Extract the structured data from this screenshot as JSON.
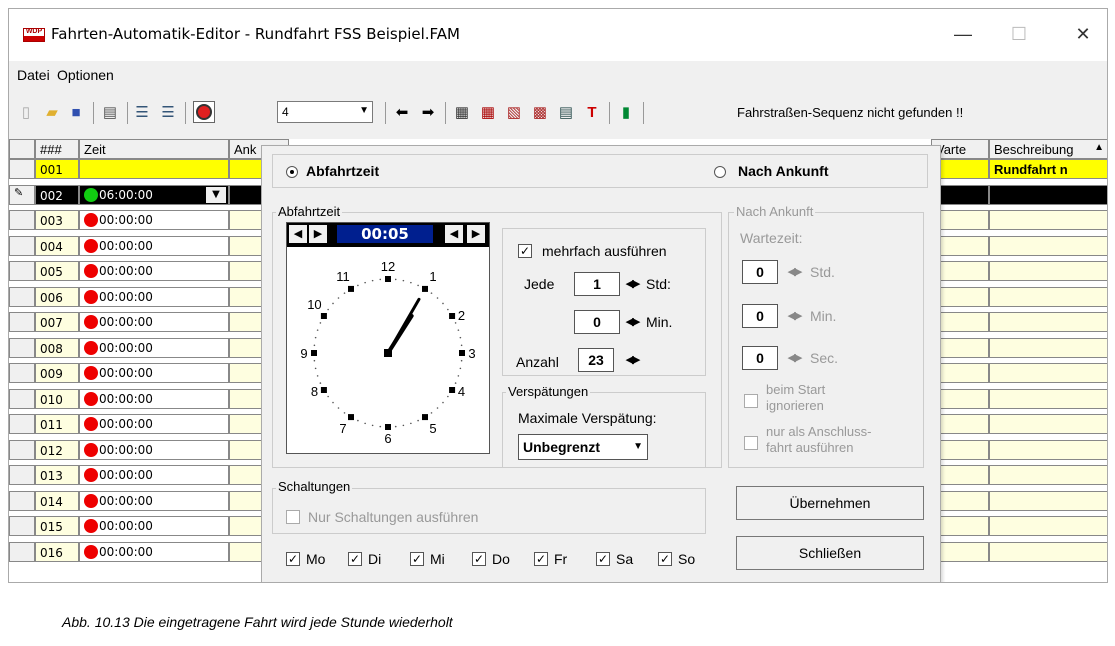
{
  "window": {
    "title": "Fahrten-Automatik-Editor - Rundfahrt FSS Beispiel.FAM",
    "icon_text": "WDP",
    "controls": [
      "—",
      "☐",
      "✕"
    ]
  },
  "menu": [
    "Datei",
    "Optionen"
  ],
  "toolbar": {
    "zoom_value": "4",
    "status": "Fahrstraßen-Sequenz nicht gefunden !!"
  },
  "grid": {
    "headers": [
      "###",
      "Zeit",
      "Ank",
      "Varte",
      "Beschreibung"
    ],
    "rows": [
      {
        "num": "001",
        "time": "",
        "desc": "Rundfahrt n"
      },
      {
        "num": "002",
        "time": "06:00:00",
        "desc": ""
      },
      {
        "num": "003",
        "time": "00:00:00"
      },
      {
        "num": "004",
        "time": "00:00:00"
      },
      {
        "num": "005",
        "time": "00:00:00"
      },
      {
        "num": "006",
        "time": "00:00:00"
      },
      {
        "num": "007",
        "time": "00:00:00"
      },
      {
        "num": "008",
        "time": "00:00:00"
      },
      {
        "num": "009",
        "time": "00:00:00"
      },
      {
        "num": "010",
        "time": "00:00:00"
      },
      {
        "num": "011",
        "time": "00:00:00"
      },
      {
        "num": "012",
        "time": "00:00:00"
      },
      {
        "num": "013",
        "time": "00:00:00"
      },
      {
        "num": "014",
        "time": "00:00:00"
      },
      {
        "num": "015",
        "time": "00:00:00"
      },
      {
        "num": "016",
        "time": "00:00:00"
      }
    ]
  },
  "dialog": {
    "mode_abfahrt": "Abfahrtzeit",
    "mode_ankunft": "Nach Ankunft",
    "abfahrt_group": "Abfahrtzeit",
    "clock_time": "00:05",
    "clock_numbers": [
      "12",
      "1",
      "2",
      "3",
      "4",
      "5",
      "6",
      "7",
      "8",
      "9",
      "10",
      "11"
    ],
    "clock_hour_value": 1,
    "clock_minute_value": 5,
    "mehrfach_label": "mehrfach ausführen",
    "jede_label": "Jede",
    "std_value": "1",
    "std_label": "Std:",
    "min_value": "0",
    "min_label": "Min.",
    "anzahl_label": "Anzahl",
    "anzahl_value": "23",
    "versp_group": "Verspätungen",
    "versp_label": "Maximale Verspätung:",
    "versp_value": "Unbegrenzt",
    "ankunft_group": "Nach Ankunft",
    "wartezeit_label": "Wartezeit:",
    "w_std": "0",
    "w_std_label": "Std.",
    "w_min": "0",
    "w_min_label": "Min.",
    "w_sec": "0",
    "w_sec_label": "Sec.",
    "beim_start": "beim Start ignorieren",
    "nur_anschluss": "nur als Anschluss-fahrt ausführen",
    "schalt_group": "Schaltungen",
    "nur_schalt": "Nur Schaltungen ausführen",
    "days": [
      "Mo",
      "Di",
      "Mi",
      "Do",
      "Fr",
      "Sa",
      "So"
    ],
    "uebernehmen": "Übernehmen",
    "schliessen": "Schließen"
  },
  "caption": "Abb. 10.13  Die eingetragene Fahrt wird jede Stunde wiederholt"
}
